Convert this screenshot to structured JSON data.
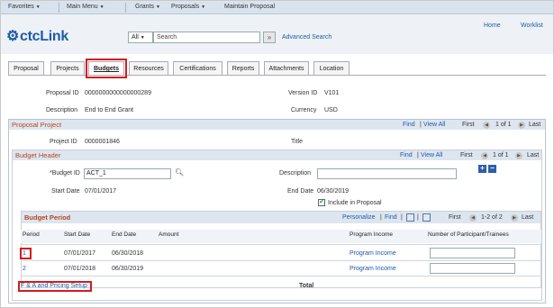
{
  "menubar": {
    "favorites": "Favorites",
    "main_menu": "Main Menu",
    "grants": "Grants",
    "proposals": "Proposals",
    "maintain": "Maintain Proposal"
  },
  "header": {
    "logo": "ctcLink",
    "home": "Home",
    "worklist": "Worklist",
    "search_scope": "All",
    "search_placeholder": "Search",
    "search_button": "»",
    "advanced_search": "Advanced Search"
  },
  "tabs": [
    "Proposal",
    "Projects",
    "Budgets",
    "Resources",
    "Certifications",
    "Reports",
    "Attachments",
    "Location"
  ],
  "proposal": {
    "proposal_id_label": "Proposal ID",
    "proposal_id": "0000000000000000289",
    "version_id_label": "Version ID",
    "version_id": "V101",
    "description_label": "Description",
    "description": "End to End Grant",
    "currency_label": "Currency",
    "currency": "USD"
  },
  "proposal_project": {
    "title": "Proposal Project",
    "find": "Find",
    "view_all": "View All",
    "first": "First",
    "counter": "1 of 1",
    "last": "Last",
    "project_id_label": "Project ID",
    "project_id": "0000001846",
    "title_label": "Title"
  },
  "budget_header": {
    "title": "Budget Header",
    "find": "Find",
    "view_all": "View All",
    "first": "First",
    "counter": "1 of 1",
    "last": "Last",
    "budget_id_label": "*Budget ID",
    "budget_id": "ACT_1",
    "description_label": "Description",
    "description": "",
    "start_date_label": "Start Date",
    "start_date": "07/01/2017",
    "end_date_label": "End Date",
    "end_date": "06/30/2019",
    "include_label": "Include in Proposal",
    "include_checked": "✔",
    "add_row": "+",
    "delete_row": "−"
  },
  "budget_period": {
    "title": "Budget Period",
    "personalize": "Personalize",
    "find": "Find",
    "first": "First",
    "counter": "1-2 of 2",
    "last": "Last",
    "columns": [
      "Period",
      "Start Date",
      "End Date",
      "Amount",
      "Program Income",
      "Number of Participant/Trainees"
    ],
    "rows": [
      {
        "period": "1",
        "start": "07/01/2017",
        "end": "06/30/2018",
        "income": "Program Income"
      },
      {
        "period": "2",
        "start": "07/01/2018",
        "end": "06/30/2019",
        "income": "Program Income"
      }
    ],
    "fa_link": "F & A and Pricing Setup",
    "total_label": "Total"
  }
}
